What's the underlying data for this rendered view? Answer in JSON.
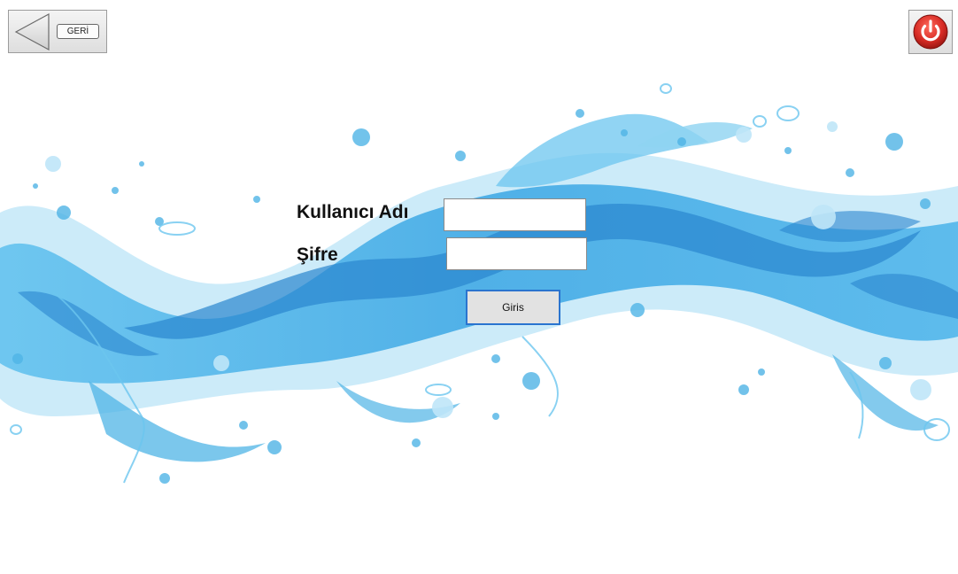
{
  "header": {
    "back_label": "GERİ"
  },
  "login": {
    "username_label": "Kullanıcı Adı",
    "password_label": "Şifre",
    "username_value": "",
    "password_value": "",
    "submit_label": "Giris"
  },
  "colors": {
    "splash_light": "#8fd3f1",
    "splash_mid": "#4fb4e6",
    "splash_dark": "#2a86cf",
    "power_red": "#d72b24",
    "focus_border": "#2a74cf"
  },
  "icons": {
    "back": "left-arrow-icon",
    "power": "power-icon"
  }
}
